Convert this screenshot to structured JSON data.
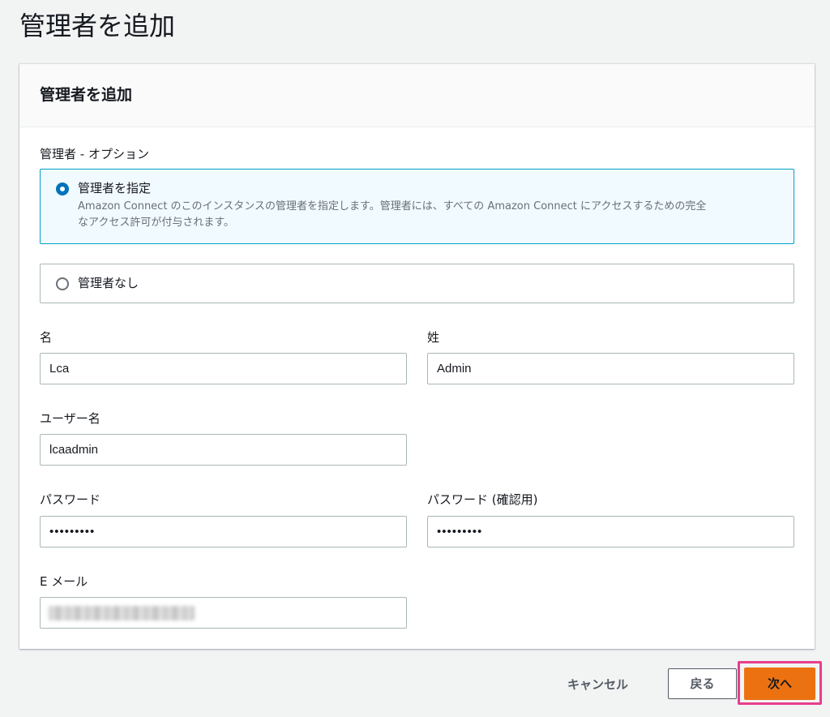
{
  "page": {
    "title": "管理者を追加"
  },
  "panel": {
    "header": "管理者を追加",
    "admin_option_label": "管理者 - オプション",
    "options": [
      {
        "title": "管理者を指定",
        "description_line1": "Amazon Connect のこのインスタンスの管理者を指定します。管理者には、すべての Amazon Connect にアクセスするための完全",
        "description_line2": "なアクセス許可が付与されます。",
        "selected": true
      },
      {
        "title": "管理者なし",
        "selected": false
      }
    ],
    "first_name": {
      "label": "名",
      "value": "Lca"
    },
    "last_name": {
      "label": "姓",
      "value": "Admin"
    },
    "username": {
      "label": "ユーザー名",
      "value": "lcaadmin"
    },
    "password": {
      "label": "パスワード",
      "value": "•••••••••"
    },
    "password_confirm": {
      "label": "パスワード (確認用)",
      "value": "•••••••••"
    },
    "email": {
      "label": "E メール"
    }
  },
  "footer": {
    "cancel_label": "キャンセル",
    "back_label": "戻る",
    "next_label": "次へ"
  },
  "colors": {
    "primary_button": "#ec7211",
    "highlight": "#e83e8c",
    "selected_border": "#00a1c9",
    "radio_checked": "#0073bb"
  }
}
